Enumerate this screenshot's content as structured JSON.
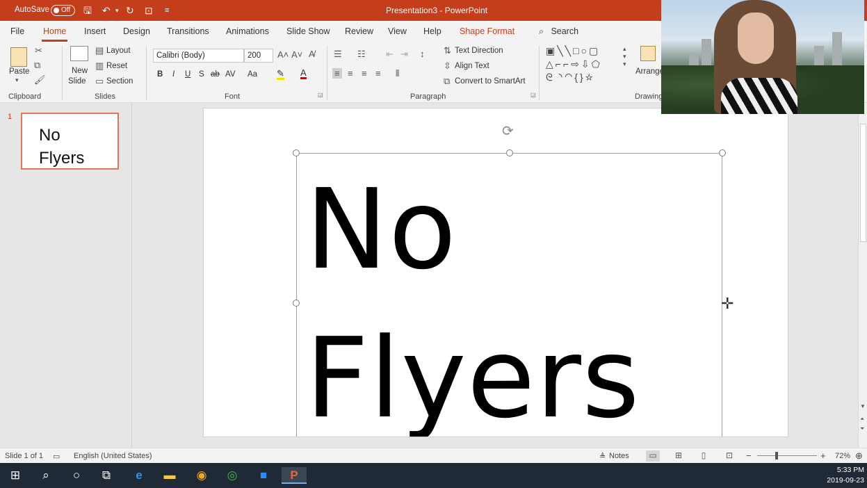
{
  "app": {
    "autosave_label": "AutoSave",
    "autosave_state": "Off",
    "title": "Presentation3  -  PowerPoint",
    "accent_color": "#c43e1c"
  },
  "tabs": [
    "File",
    "Home",
    "Insert",
    "Design",
    "Transitions",
    "Animations",
    "Slide Show",
    "Review",
    "View",
    "Help",
    "Shape Format"
  ],
  "search_label": "Search",
  "ribbon": {
    "clipboard": {
      "paste": "Paste",
      "label": "Clipboard"
    },
    "slides": {
      "new_slide_1": "New",
      "new_slide_2": "Slide",
      "layout": "Layout",
      "reset": "Reset",
      "section": "Section",
      "label": "Slides"
    },
    "font": {
      "font_name": "Calibri (Body)",
      "font_size": "200",
      "bold": "B",
      "italic": "I",
      "underline": "U",
      "shadow": "S",
      "strike": "ab",
      "spacing": "AV",
      "case": "Aa",
      "label": "Font"
    },
    "paragraph": {
      "text_direction": "Text Direction",
      "align_text": "Align Text",
      "smartart": "Convert to SmartArt",
      "label": "Paragraph"
    },
    "drawing": {
      "arrange": "Arrange",
      "label": "Drawing"
    }
  },
  "thumbnail": {
    "number": "1",
    "line1": "No",
    "line2": "Flyers"
  },
  "slide": {
    "line1": "No",
    "line2": "Flyers"
  },
  "statusbar": {
    "slide_of": "Slide 1 of 1",
    "language": "English (United States)",
    "notes": "Notes",
    "zoom": "72%"
  },
  "taskbar": {
    "time": "5:33 PM",
    "date": "2019-09-23"
  }
}
